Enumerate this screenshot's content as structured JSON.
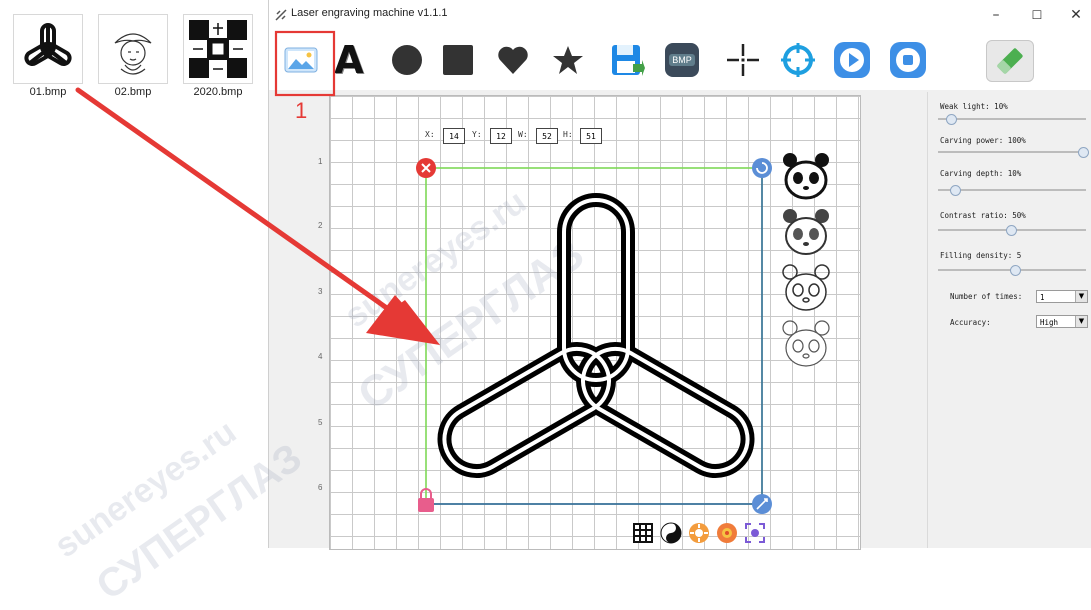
{
  "desktop": {
    "files": [
      {
        "name": "01.bmp",
        "icon": "triskelion-icon"
      },
      {
        "name": "02.bmp",
        "icon": "sketch-portrait-icon"
      },
      {
        "name": "2020.bmp",
        "icon": "checker-pattern-icon"
      }
    ]
  },
  "window": {
    "title": "Laser engraving machine v1.1.1",
    "controls": {
      "minimize": "–",
      "maximize": "☐",
      "close": "✕"
    }
  },
  "toolbar": {
    "items": [
      "image-open-icon",
      "text-a-icon",
      "circle-icon",
      "square-icon",
      "heart-icon",
      "star-icon",
      "save-icon",
      "bmp-icon",
      "crosshair-icon",
      "target-icon",
      "play-icon",
      "stop-icon",
      "eraser-icon"
    ],
    "bmp_label": "BMP",
    "text_label": "A"
  },
  "annotation": {
    "number": "1",
    "color": "#e53935"
  },
  "canvas": {
    "x_label": "X:",
    "x_value": "14",
    "y_label": "Y:",
    "y_value": "12",
    "w_label": "W:",
    "w_value": "52",
    "h_label": "H:",
    "h_value": "51",
    "ruler": [
      "1",
      "2",
      "3",
      "4",
      "5",
      "6"
    ],
    "bottom_icons": [
      "grid-icon",
      "yin-yang-icon",
      "orange-gear-icon",
      "orange-flower-icon",
      "focus-frame-icon"
    ],
    "presets": [
      "panda-filled-icon",
      "panda-sketch-icon",
      "panda-outline-icon",
      "panda-outline-light-icon"
    ]
  },
  "settings": {
    "weak_light": "Weak light: 10%",
    "carving_power": "Carving power: 100%",
    "carving_depth": "Carving depth: 10%",
    "contrast_ratio": "Contrast ratio: 50%",
    "filling_density": "Filling density: 5",
    "number_of_times_label": "Number of times:",
    "number_of_times_value": "1",
    "accuracy_label": "Accuracy:",
    "accuracy_value": "High",
    "levels": {
      "weak_light": 0.1,
      "carving_power": 1.0,
      "carving_depth": 0.1,
      "contrast_ratio": 0.5,
      "filling_density": 0.5
    }
  },
  "watermark": [
    "sunereyes.ru",
    "СУПЕРГЛАЗ"
  ],
  "colors": {
    "accent_red": "#e53935",
    "selection_green": "#7ed957",
    "handle_blue": "#5b8ed6",
    "handle_pink": "#e85d8c"
  }
}
